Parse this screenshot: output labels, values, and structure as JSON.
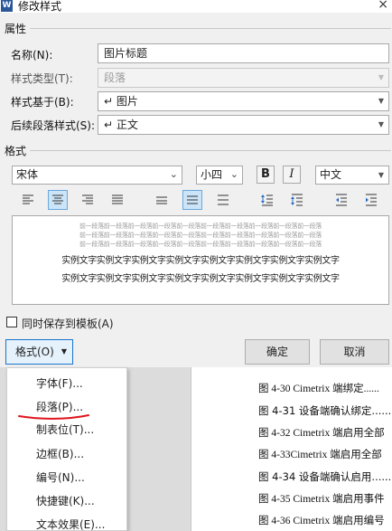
{
  "window": {
    "title": "修改样式",
    "app_icon": "W",
    "close_glyph": "×"
  },
  "attributes": {
    "section_label": "属性",
    "name": {
      "label": "名称(N):",
      "value": "图片标题"
    },
    "style_type": {
      "label": "样式类型(T):",
      "value": "段落"
    },
    "based_on": {
      "label": "样式基于(B):",
      "value": "↵ 图片"
    },
    "next_style": {
      "label": "后续段落样式(S):",
      "value": "↵ 正文"
    }
  },
  "formatting": {
    "section_label": "格式",
    "font": "宋体",
    "size": "小四",
    "bold": "B",
    "italic": "I",
    "script": "中文",
    "active_align": "center",
    "active_spacing": "1.5"
  },
  "preview": {
    "prev_paragraph": "前一段落前一段落前一段落前一段落前一段落前一段落前一段落前一段落前一段落前一段落",
    "sample_text": "实例文字实例文字实例文字实例文字实例文字实例文字实例文字实例文字"
  },
  "options": {
    "add_to_template": "同时保存到模板(A)",
    "checked": false
  },
  "buttons": {
    "format": "格式(O)",
    "ok": "确定",
    "cancel": "取消"
  },
  "format_menu": [
    "字体(F)...",
    "段落(P)...",
    "制表位(T)...",
    "边框(B)...",
    "编号(N)...",
    "快捷键(K)...",
    "文本效果(E)..."
  ],
  "document_toc": [
    "图 4-30 Cimetrix 端绑定......",
    "图 4-31  设备端确认绑定......",
    "图 4-32 Cimetrix 端启用全部",
    "图 4-33Cimetrix 端启用全部",
    "图 4-34  设备端确认启用......",
    "图 4-35 Cimetrix 端启用事件",
    "图 4-36 Cimetrix 端启用编号"
  ],
  "colors": {
    "accent": "#1a74c9",
    "active_bg": "#cce4f7",
    "annotation": "#e0141e"
  }
}
